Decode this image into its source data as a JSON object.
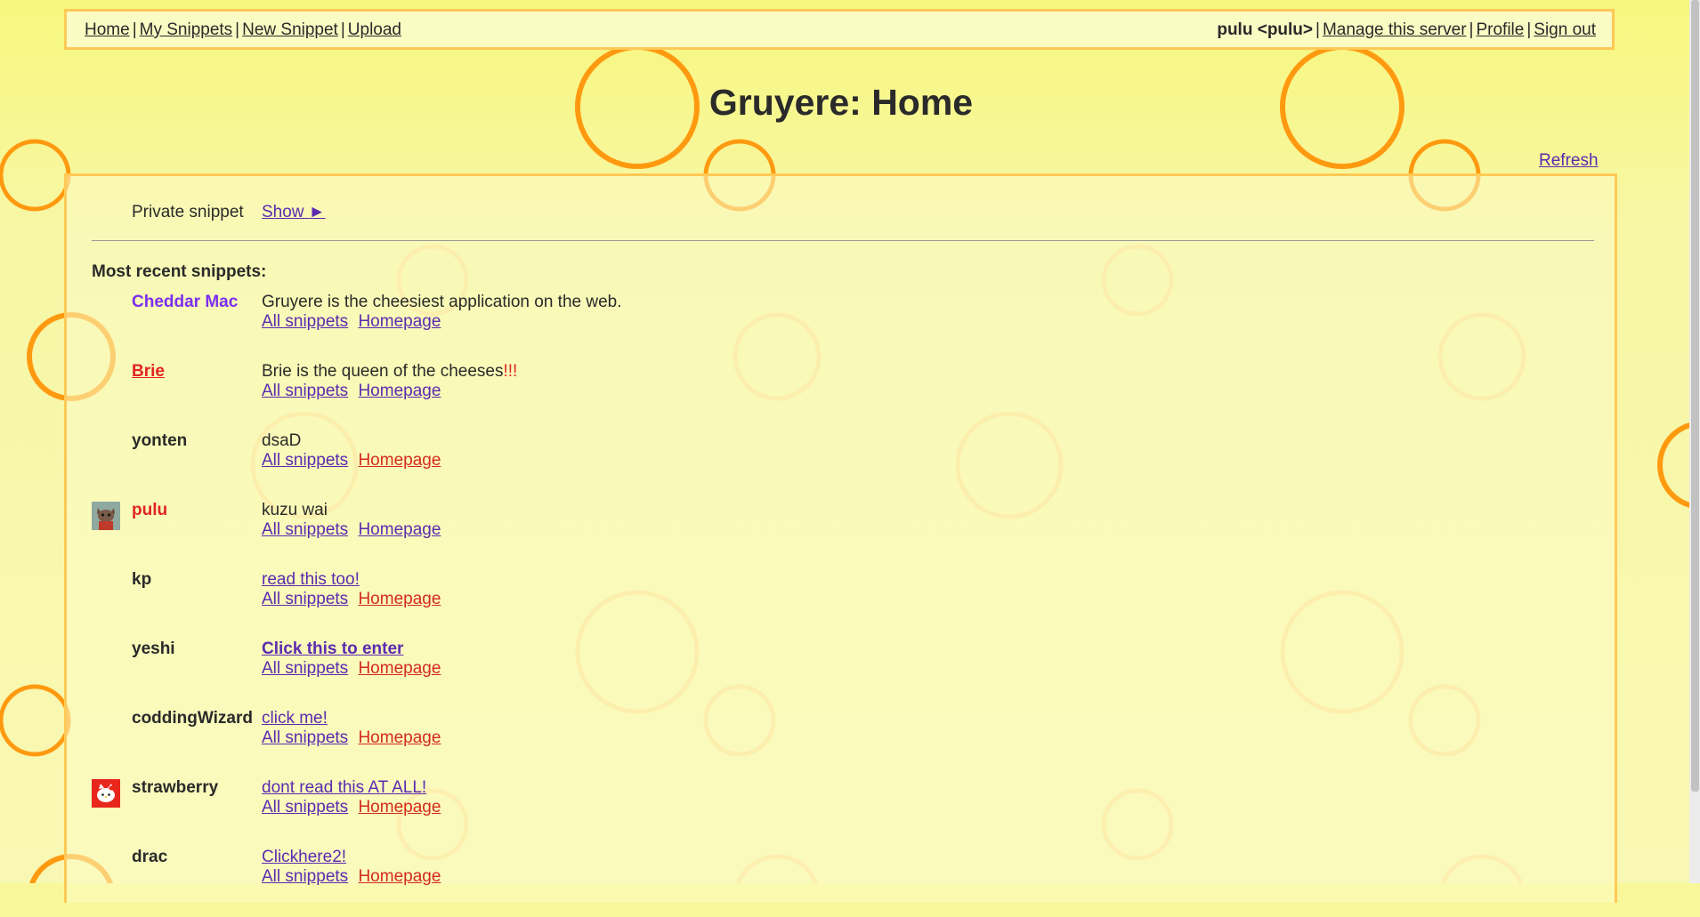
{
  "menu": {
    "home": "Home",
    "my_snippets": "My Snippets",
    "new_snippet": "New Snippet",
    "upload": "Upload",
    "separator": "|",
    "user": "pulu <pulu>",
    "manage_server": "Manage this server",
    "profile": "Profile",
    "sign_out": "Sign out"
  },
  "page": {
    "title": "Gruyere: Home",
    "refresh": "Refresh"
  },
  "private": {
    "label": "Private snippet",
    "show": "Show ►"
  },
  "recent": {
    "heading": "Most recent snippets:",
    "all_snippets_label": "All snippets",
    "homepage_label": "Homepage",
    "snippets": [
      {
        "author": "Cheddar Mac",
        "text": "Gruyere is the cheesiest application on the web."
      },
      {
        "author": "Brie",
        "text": "Brie is the queen of the cheeses",
        "text_suffix": "!!!"
      },
      {
        "author": "yonten",
        "text": "dsaD"
      },
      {
        "author": "pulu",
        "text": "kuzu wai",
        "avatar_icon": "cat-avatar-icon"
      },
      {
        "author": "kp",
        "text": "read this too!"
      },
      {
        "author": "yeshi",
        "text": "Click this to enter"
      },
      {
        "author": "coddingWizard",
        "text": "click me!"
      },
      {
        "author": "strawberry",
        "text": "dont read this AT ALL!",
        "avatar_icon": "hello-kitty-avatar-icon"
      },
      {
        "author": "drac",
        "text": "Clickhere2!"
      }
    ]
  },
  "colors": {
    "background": "#f8f89a",
    "border": "#ffc956",
    "circle": "#ff9a10",
    "link": "#5b2bb0",
    "alert_red": "#e02424",
    "author_purple": "#7b2ff0"
  }
}
